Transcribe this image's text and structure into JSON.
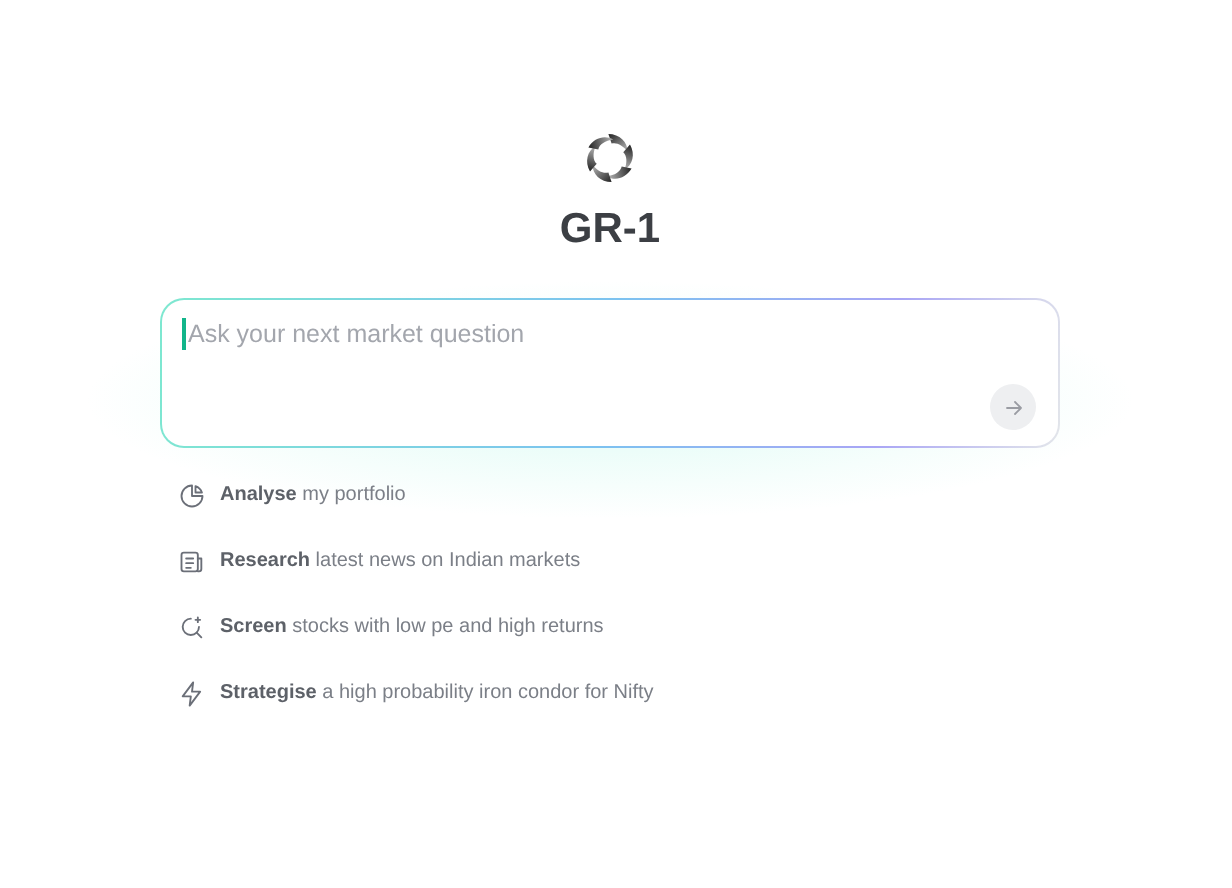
{
  "brand": {
    "title": "GR-1"
  },
  "prompt": {
    "placeholder": "Ask your next market question"
  },
  "suggestions": [
    {
      "kind": "pie",
      "text": "**Analyse** my portfolio"
    },
    {
      "kind": "news",
      "text": "**Research** latest news on Indian markets"
    },
    {
      "kind": "search",
      "text": "**Screen** stocks with low pe and high returns"
    },
    {
      "kind": "bolt",
      "text": "**Strategise** a high probability iron condor for Nifty"
    }
  ]
}
